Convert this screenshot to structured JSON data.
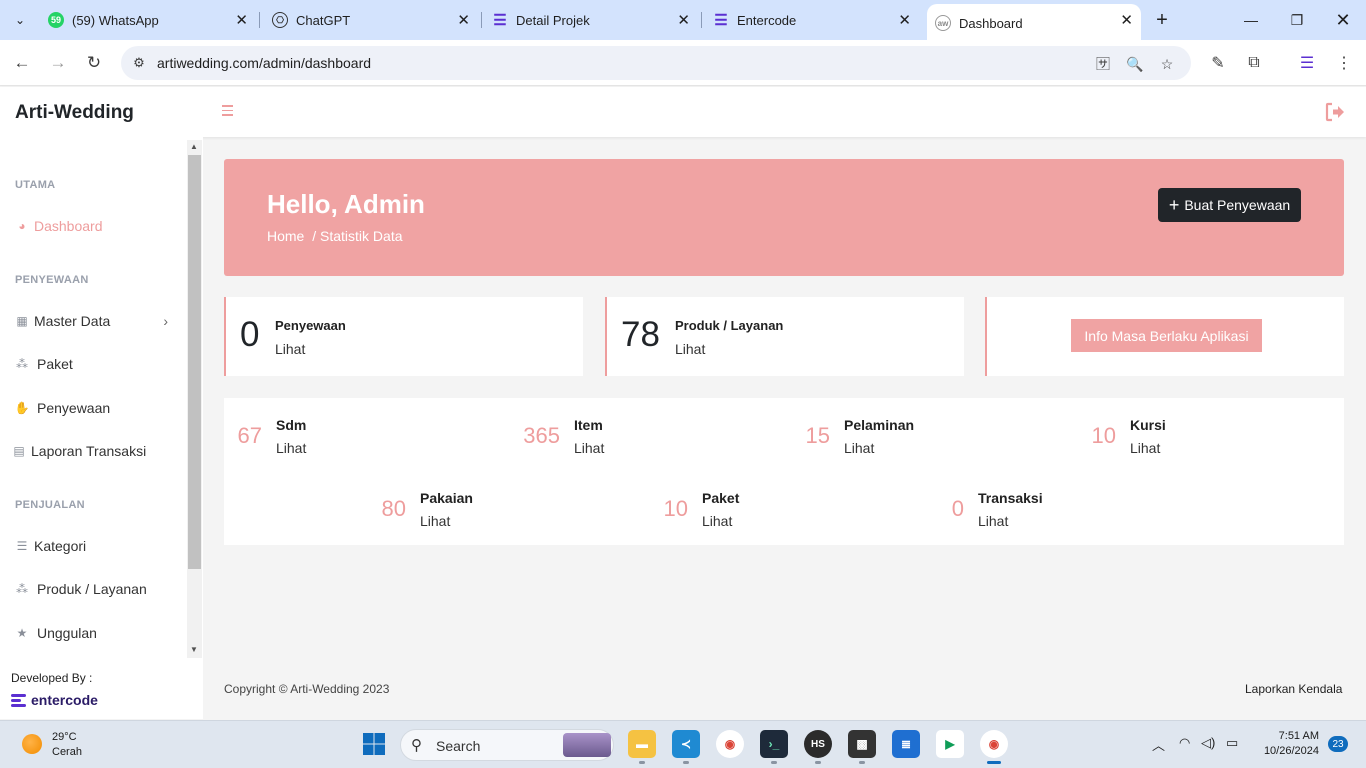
{
  "browser": {
    "tabs": [
      {
        "title": "(59) WhatsApp",
        "badge": "59"
      },
      {
        "title": "ChatGPT"
      },
      {
        "title": "Detail Projek"
      },
      {
        "title": "Entercode"
      },
      {
        "title": "Dashboard"
      }
    ],
    "url": "artiwedding.com/admin/dashboard"
  },
  "app": {
    "brand": "Arti-Wedding"
  },
  "sidebar": {
    "sections": [
      {
        "heading": "UTAMA",
        "items": [
          {
            "label": "Dashboard",
            "icon": "palette-icon",
            "active": true
          }
        ]
      },
      {
        "heading": "PENYEWAAN",
        "items": [
          {
            "label": "Master Data",
            "icon": "table-icon",
            "has_children": true
          },
          {
            "label": "Paket",
            "icon": "cubes-icon"
          },
          {
            "label": "Penyewaan",
            "icon": "handshake-icon"
          },
          {
            "label": "Laporan Transaksi",
            "icon": "file-icon"
          }
        ]
      },
      {
        "heading": "PENJUALAN",
        "items": [
          {
            "label": "Kategori",
            "icon": "list-icon"
          },
          {
            "label": "Produk / Layanan",
            "icon": "cubes-icon"
          },
          {
            "label": "Unggulan",
            "icon": "star-icon"
          }
        ]
      }
    ],
    "developed_by": "Developed By :",
    "developer_logo": "entercode"
  },
  "hero": {
    "title": "Hello, Admin",
    "breadcrumb_home": "Home",
    "breadcrumb_current": "/ Statistik Data",
    "button_label": "Buat Penyewaan"
  },
  "top_stats": [
    {
      "value": "0",
      "label": "Penyewaan",
      "link": "Lihat"
    },
    {
      "value": "78",
      "label": "Produk / Layanan",
      "link": "Lihat"
    }
  ],
  "info_button": "Info Masa Berlaku Aplikasi",
  "mini_stats": [
    {
      "value": "67",
      "label": "Sdm",
      "link": "Lihat"
    },
    {
      "value": "365",
      "label": "Item",
      "link": "Lihat"
    },
    {
      "value": "15",
      "label": "Pelaminan",
      "link": "Lihat"
    },
    {
      "value": "10",
      "label": "Kursi",
      "link": "Lihat"
    },
    {
      "value": "80",
      "label": "Pakaian",
      "link": "Lihat"
    },
    {
      "value": "10",
      "label": "Paket",
      "link": "Lihat"
    },
    {
      "value": "0",
      "label": "Transaksi",
      "link": "Lihat"
    }
  ],
  "footer": {
    "copyright": "Copyright © Arti-Wedding 2023",
    "report_link": "Laporkan Kendala"
  },
  "taskbar": {
    "weather_temp": "29°C",
    "weather_desc": "Cerah",
    "search_placeholder": "Search",
    "time": "7:51 AM",
    "date": "10/26/2024",
    "notification_count": "23"
  },
  "colors": {
    "accent": "#f0a3a3",
    "accent_text": "#ee9d9d",
    "dark_button": "#212529"
  }
}
